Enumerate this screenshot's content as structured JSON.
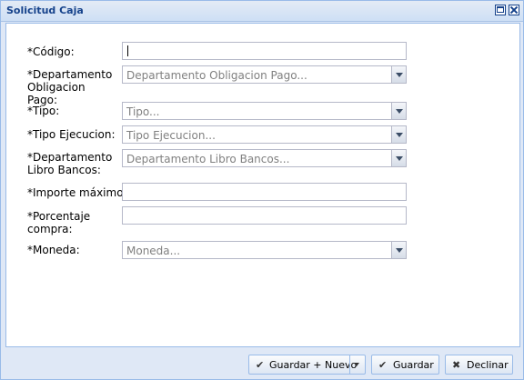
{
  "window": {
    "title": "Solicitud Caja",
    "maximize_icon": "maximize-icon",
    "close_icon": "close-icon"
  },
  "form": {
    "codigo": {
      "label": "*Código:",
      "value": ""
    },
    "departamento_obligacion": {
      "label": "*Departamento Obligacion Pago:",
      "placeholder": "Departamento Obligacion Pago..."
    },
    "tipo": {
      "label": "*Tipo:",
      "placeholder": "Tipo..."
    },
    "tipo_ejecucion": {
      "label": "*Tipo Ejecucion:",
      "placeholder": "Tipo Ejecucion..."
    },
    "departamento_libro": {
      "label": "*Departamento Libro Bancos:",
      "placeholder": "Departamento Libro Bancos..."
    },
    "importe_maximo": {
      "label": "*Importe máximo:",
      "value": ""
    },
    "porcentaje_compra": {
      "label": "*Porcentaje compra:",
      "value": ""
    },
    "moneda": {
      "label": "*Moneda:",
      "placeholder": "Moneda..."
    }
  },
  "buttons": {
    "guardar_nuevo": "Guardar + Nuevo",
    "guardar": "Guardar",
    "declinar": "Declinar"
  },
  "icons": {
    "check": "✔",
    "cross": "✖"
  }
}
